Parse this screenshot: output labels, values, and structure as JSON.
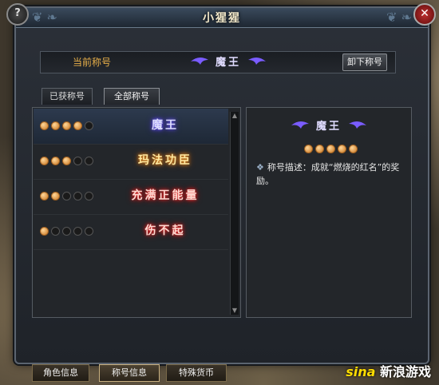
{
  "window": {
    "title": "小猩猩"
  },
  "current": {
    "label": "当前称号",
    "title": "魔王",
    "unequip": "卸下称号"
  },
  "tabs": [
    {
      "label": "已获称号"
    },
    {
      "label": "全部称号"
    }
  ],
  "titles": [
    {
      "name": "魔王",
      "stars": 4
    },
    {
      "name": "玛法功臣",
      "stars": 3
    },
    {
      "name": "充满正能量",
      "stars": 2
    },
    {
      "name": "伤不起",
      "stars": 1
    }
  ],
  "detail": {
    "title": "魔王",
    "stars": 5,
    "description": "称号描述：成就“燃烧的红名”的奖励。"
  },
  "bottom_tabs": [
    {
      "label": "角色信息"
    },
    {
      "label": "称号信息"
    },
    {
      "label": "特殊货币"
    }
  ],
  "watermark": {
    "brand": "sina",
    "text": "新浪游戏"
  }
}
